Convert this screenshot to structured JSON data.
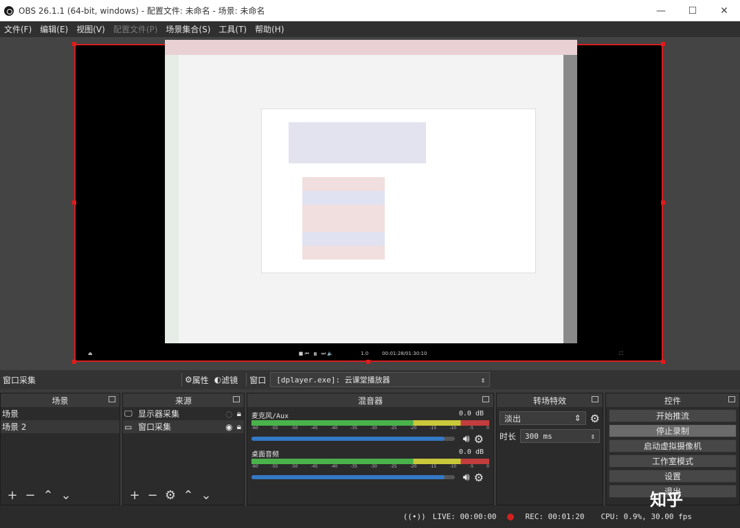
{
  "window": {
    "title": "OBS 26.1.1 (64-bit, windows) - 配置文件: 未命名 - 场景: 未命名"
  },
  "menu": [
    "文件(F)",
    "编辑(E)",
    "视图(V)",
    "配置文件(P)",
    "场景集合(S)",
    "工具(T)",
    "帮助(H)"
  ],
  "player": {
    "time": "00:01:28/01:30:10",
    "speed": "1.0"
  },
  "source_bar": {
    "current_source": "窗口采集",
    "properties": "属性",
    "filters": "滤镜",
    "window_label": "窗口",
    "window_value": "[dplayer.exe]: 云课堂播放器"
  },
  "scenes": {
    "title": "场景",
    "items": [
      "场景",
      "场景 2"
    ]
  },
  "sources": {
    "title": "来源",
    "items": [
      "显示器采集",
      "窗口采集"
    ]
  },
  "mixer": {
    "title": "混音器",
    "channels": [
      {
        "name": "麦克风/Aux",
        "db": "0.0 dB"
      },
      {
        "name": "桌面音频",
        "db": "0.0 dB"
      }
    ],
    "ticks": [
      "-60",
      "-55",
      "-50",
      "-45",
      "-40",
      "-35",
      "-30",
      "-25",
      "-20",
      "-15",
      "-10",
      "-5",
      "0"
    ]
  },
  "transitions": {
    "title": "转场特效",
    "selected": "淡出",
    "duration_label": "时长",
    "duration": "300 ms"
  },
  "controls": {
    "title": "控件",
    "buttons": [
      "开始推流",
      "停止录制",
      "启动虚拟摄像机",
      "工作室模式",
      "设置",
      "退出"
    ]
  },
  "status": {
    "live": "LIVE: 00:00:00",
    "rec": "REC: 00:01:20",
    "cpu": "CPU: 0.9%, 30.00 fps"
  },
  "watermark": "知乎",
  "colors": {
    "bg": "#3b3b3b",
    "panel": "#2b2b2b",
    "accent_red": "#d91e1e",
    "volume_blue": "#3478c6"
  }
}
